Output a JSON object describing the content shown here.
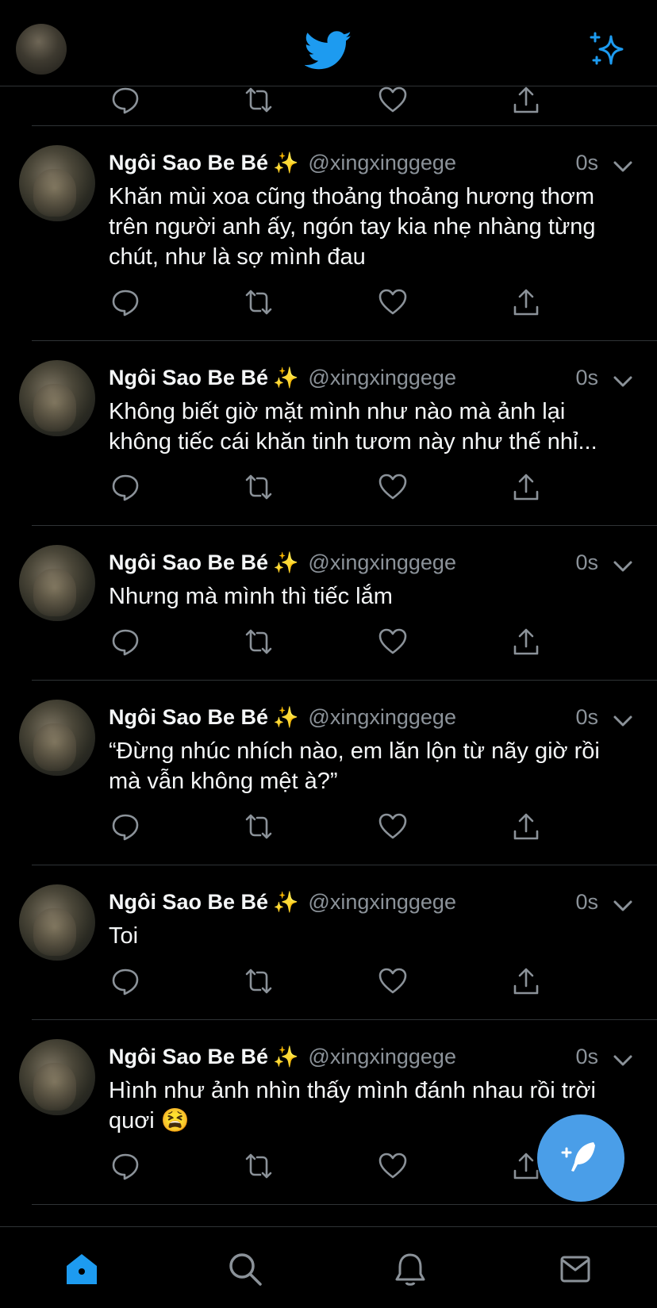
{
  "header": {
    "profile_avatar": "user-avatar",
    "logo_icon": "twitter-bird-icon",
    "sparkle_icon": "sparkle-icon"
  },
  "tweets": [
    {
      "name": "Ngôi Sao Be Bé",
      "emoji": "✨",
      "handle": "@xingxinggege",
      "time": "0s",
      "text": "Khăn mùi xoa cũng thoảng thoảng hương thơm trên người anh ấy, ngón tay kia nhẹ nhàng từng chút, như là sợ mình đau"
    },
    {
      "name": "Ngôi Sao Be Bé",
      "emoji": "✨",
      "handle": "@xingxinggege",
      "time": "0s",
      "text": "Không biết giờ mặt mình như nào mà ảnh lại không tiếc cái khăn tinh tươm này như thế nhỉ..."
    },
    {
      "name": "Ngôi Sao Be Bé",
      "emoji": "✨",
      "handle": "@xingxinggege",
      "time": "0s",
      "text": "Nhưng mà mình thì tiếc lắm"
    },
    {
      "name": "Ngôi Sao Be Bé",
      "emoji": "✨",
      "handle": "@xingxinggege",
      "time": "0s",
      "text": "“Đừng nhúc nhích nào, em lăn lộn từ nãy giờ rồi mà vẫn không mệt à?”"
    },
    {
      "name": "Ngôi Sao Be Bé",
      "emoji": "✨",
      "handle": "@xingxinggege",
      "time": "0s",
      "text": "Toi"
    },
    {
      "name": "Ngôi Sao Be Bé",
      "emoji": "✨",
      "handle": "@xingxinggege",
      "time": "0s",
      "text": "Hình như ảnh nhìn thấy mình đánh nhau rồi trời quơi 😫"
    }
  ],
  "action_icons": [
    "reply-icon",
    "retweet-icon",
    "like-icon",
    "share-icon"
  ],
  "fab": {
    "icon": "compose-tweet-icon"
  },
  "tabbar": {
    "items": [
      "home-icon",
      "search-icon",
      "notifications-icon",
      "messages-icon"
    ]
  },
  "colors": {
    "accent": "#1d9bf0",
    "fab": "#4a9ee8",
    "divider": "#2f3336",
    "muted": "#8b9299"
  }
}
